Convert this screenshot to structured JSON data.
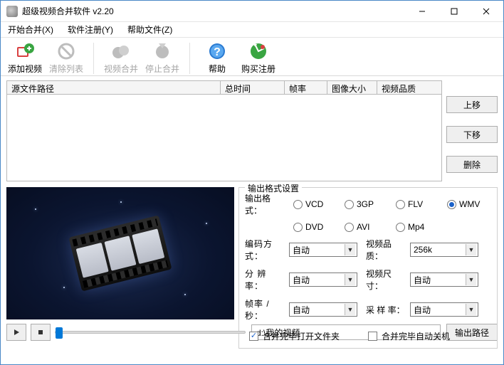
{
  "window": {
    "title": "超级视频合并软件 v2.20"
  },
  "menu": {
    "start": "开始合并(X)",
    "register": "软件注册(Y)",
    "help": "帮助文件(Z)"
  },
  "toolbar": {
    "add": "添加视频",
    "clear": "清除列表",
    "merge": "视频合并",
    "stop": "停止合并",
    "help": "帮助",
    "buy": "购买注册"
  },
  "table": {
    "col_path": "源文件路径",
    "col_duration": "总时间",
    "col_fps": "帧率",
    "col_size": "图像大小",
    "col_quality": "视频品质"
  },
  "side": {
    "up": "上移",
    "down": "下移",
    "delete": "删除"
  },
  "settings": {
    "group_title": "输出格式设置",
    "format_label": "输出格式：",
    "formats": {
      "VCD": "VCD",
      "GP3": "3GP",
      "FLV": "FLV",
      "WMV": "WMV",
      "DVD": "DVD",
      "AVI": "AVI",
      "MP4": "Mp4"
    },
    "selected_format": "WMV",
    "encode_label": "编码方式：",
    "encode_value": "自动",
    "quality_label": "视频品质：",
    "quality_value": "256k",
    "resolution_label": "分 辨 率：",
    "resolution_value": "自动",
    "videosize_label": "视频尺寸：",
    "videosize_value": "自动",
    "fps_label": "帧率 /秒：",
    "fps_value": "自动",
    "samplerate_label": "采 样 率：",
    "samplerate_value": "自动",
    "check_open_folder": "合并完毕打开文件夹",
    "check_open_folder_checked": true,
    "check_shutdown": "合并完毕自动关机",
    "check_shutdown_checked": false
  },
  "footer": {
    "output_path": "d:\\我的视频",
    "output_btn": "输出路径"
  }
}
